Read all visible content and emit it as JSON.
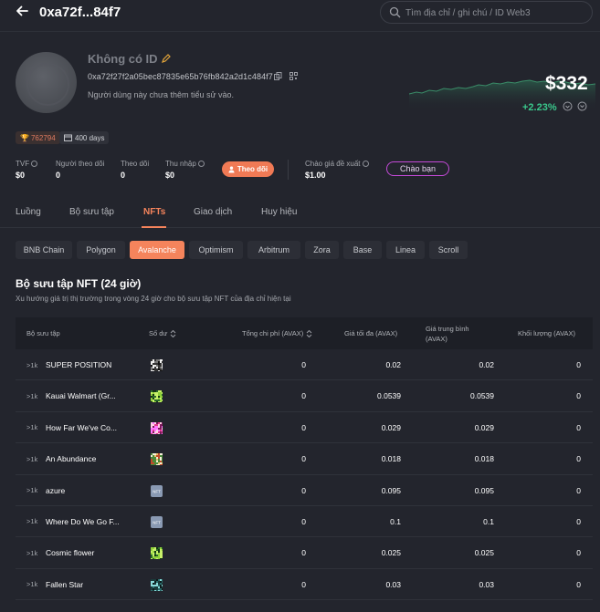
{
  "header": {
    "address_short": "0xa72f...84f7",
    "search_placeholder": "Tìm địa chỉ / ghi chú / ID Web3"
  },
  "profile": {
    "name": "Không có ID",
    "full_address": "0xa72f27f2a05bec87835e65b76fb842a2d1c484f7",
    "bio": "Người dùng này chưa thêm tiểu sử vào.",
    "net_worth": "$332",
    "change": "+2.23%",
    "badge_rank": "762794",
    "badge_days": "400 days",
    "accent_color": "#f5845c",
    "positive_color": "#3ac88c"
  },
  "stats": [
    {
      "label": "TVF",
      "value": "$0",
      "help": true
    },
    {
      "label": "Người theo dõi",
      "value": "0",
      "help": false
    },
    {
      "label": "Theo dõi",
      "value": "0",
      "help": false
    },
    {
      "label": "Thu nhập",
      "value": "$0",
      "help": true
    }
  ],
  "follow_button": "Theo dõi",
  "offer": {
    "label": "Chào giá đề xuất",
    "value": "$1.00",
    "button": "Chào bạn"
  },
  "tabs": [
    "Luồng",
    "Bộ sưu tập",
    "NFTs",
    "Giao dịch",
    "Huy hiệu"
  ],
  "active_tab": "NFTs",
  "chains": [
    "BNB Chain",
    "Polygon",
    "Avalanche",
    "Optimism",
    "Arbitrum",
    "Zora",
    "Base",
    "Linea",
    "Scroll"
  ],
  "active_chain": "Avalanche",
  "section": {
    "title": "Bộ sưu tập NFT (24 giờ)",
    "subtitle": "Xu hướng giá trị thị trường trong vòng 24 giờ cho bộ sưu tập NFT của địa chỉ hiện tại"
  },
  "table": {
    "headers": {
      "collection": "Bộ sưu tập",
      "balance": "Số dư",
      "total_fee": "Tổng chi phí (AVAX)",
      "max_price": "Giá tối đa (AVAX)",
      "avg_price_line1": "Giá trung bình",
      "avg_price_line2": "(AVAX)",
      "volume": "Khối lượng (AVAX)"
    },
    "rows": [
      {
        "rank": ">1k",
        "name": "SUPER POSITION",
        "thumb": "pixel-bw",
        "total": "0",
        "max": "0.02",
        "avg": "0.02",
        "volume": "0"
      },
      {
        "rank": ">1k",
        "name": "Kauai Walmart (Gr...",
        "thumb": "pixel-green",
        "total": "0",
        "max": "0.0539",
        "avg": "0.0539",
        "volume": "0"
      },
      {
        "rank": ">1k",
        "name": "How Far We've Co...",
        "thumb": "pixel-pink",
        "total": "0",
        "max": "0.029",
        "avg": "0.029",
        "volume": "0"
      },
      {
        "rank": ">1k",
        "name": "An Abundance",
        "thumb": "pixel-multi",
        "total": "0",
        "max": "0.018",
        "avg": "0.018",
        "volume": "0"
      },
      {
        "rank": ">1k",
        "name": "azure",
        "thumb": "nft-placeholder",
        "total": "0",
        "max": "0.095",
        "avg": "0.095",
        "volume": "0"
      },
      {
        "rank": ">1k",
        "name": "Where Do We Go F...",
        "thumb": "nft-placeholder",
        "total": "0",
        "max": "0.1",
        "avg": "0.1",
        "volume": "0"
      },
      {
        "rank": ">1k",
        "name": "Cosmic flower",
        "thumb": "pixel-green",
        "total": "0",
        "max": "0.025",
        "avg": "0.025",
        "volume": "0"
      },
      {
        "rank": ">1k",
        "name": "Fallen Star",
        "thumb": "pixel-dark",
        "total": "0",
        "max": "0.03",
        "avg": "0.03",
        "volume": "0"
      }
    ],
    "nft_placeholder_text": "NFT"
  }
}
